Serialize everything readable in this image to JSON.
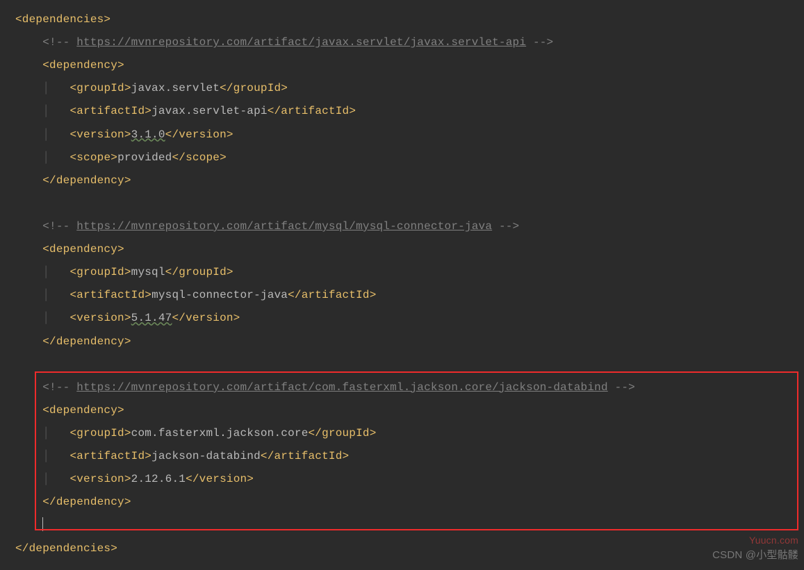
{
  "colors": {
    "tag": "#e8bf6a",
    "text": "#bababa",
    "comment": "#808080",
    "bg": "#2b2b2b",
    "highlight_border": "#ee2b2b"
  },
  "root_open": "<dependencies>",
  "root_close": "</dependencies>",
  "dep1": {
    "comment_open": "<!-- ",
    "url": "https://mvnrepository.com/artifact/javax.servlet/javax.servlet-api",
    "comment_close": " -->",
    "open": "<dependency>",
    "groupId_open": "<groupId>",
    "groupId": "javax.servlet",
    "groupId_close": "</groupId>",
    "artifactId_open": "<artifactId>",
    "artifactId": "javax.servlet-api",
    "artifactId_close": "</artifactId>",
    "version_open": "<version>",
    "version": "3.1.0",
    "version_close": "</version>",
    "scope_open": "<scope>",
    "scope": "provided",
    "scope_close": "</scope>",
    "close": "</dependency>"
  },
  "dep2": {
    "comment_open": "<!-- ",
    "url": "https://mvnrepository.com/artifact/mysql/mysql-connector-java",
    "comment_close": " -->",
    "open": "<dependency>",
    "groupId_open": "<groupId>",
    "groupId": "mysql",
    "groupId_close": "</groupId>",
    "artifactId_open": "<artifactId>",
    "artifactId": "mysql-connector-java",
    "artifactId_close": "</artifactId>",
    "version_open": "<version>",
    "version": "5.1.47",
    "version_close": "</version>",
    "close": "</dependency>"
  },
  "dep3": {
    "comment_open": "<!-- ",
    "url": "https://mvnrepository.com/artifact/com.fasterxml.jackson.core/jackson-databind",
    "comment_close": " -->",
    "open": "<dependency>",
    "groupId_open": "<groupId>",
    "groupId": "com.fasterxml.jackson.core",
    "groupId_close": "</groupId>",
    "artifactId_open": "<artifactId>",
    "artifactId": "jackson-databind",
    "artifactId_close": "</artifactId>",
    "version_open": "<version>",
    "version": "2.12.6.1",
    "version_close": "</version>",
    "close": "</dependency>"
  },
  "watermark1": "Yuucn.com",
  "watermark2": "CSDN @小型骷髅"
}
